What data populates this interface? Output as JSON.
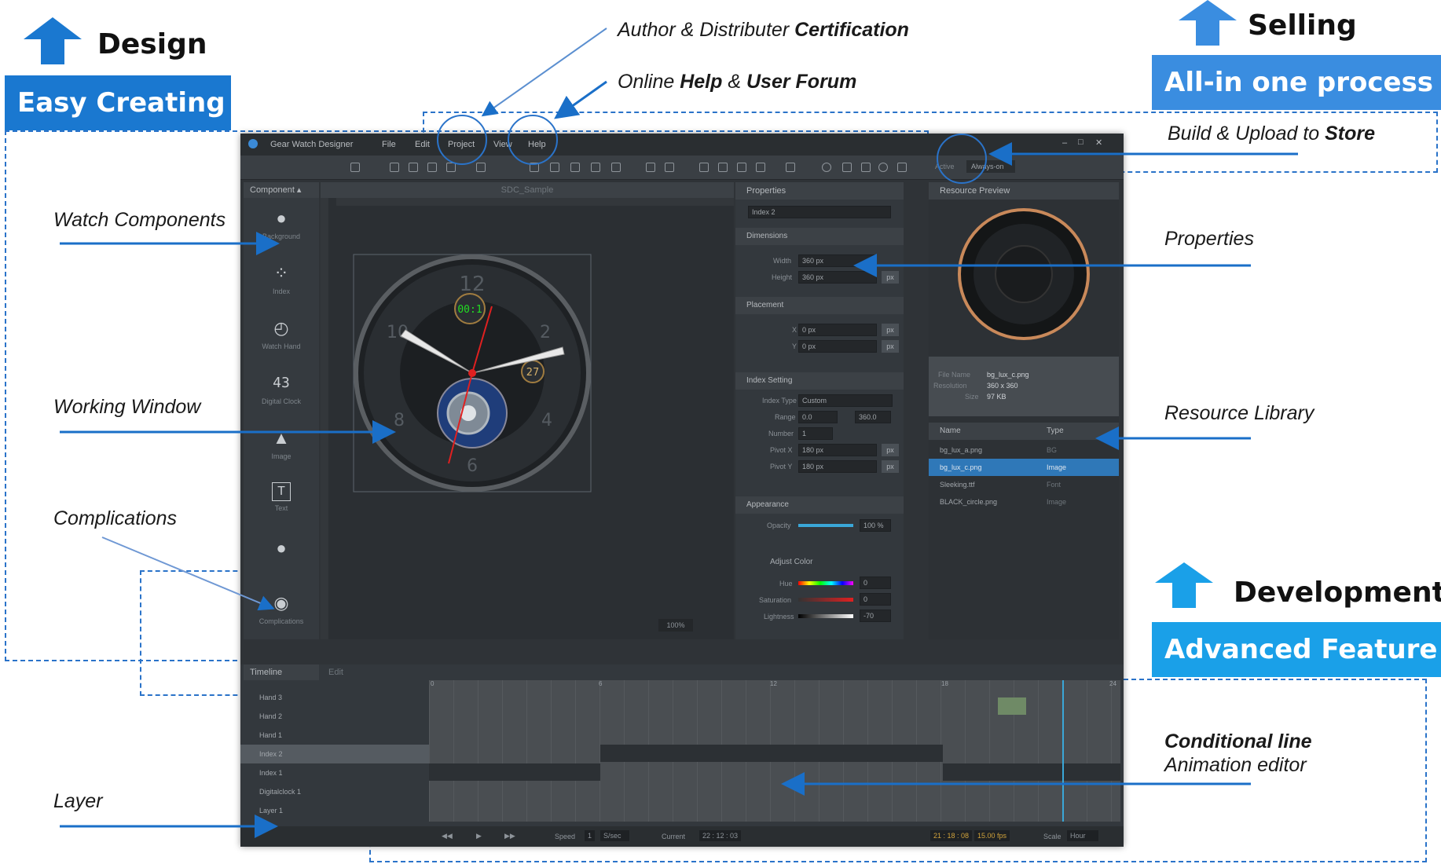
{
  "sections": {
    "design": {
      "title": "Design",
      "banner": "Easy Creating"
    },
    "selling": {
      "title": "Selling",
      "banner": "All-in one process"
    },
    "development": {
      "title": "Development",
      "banner": "Advanced Feature"
    }
  },
  "callouts": {
    "author_prefix": "Author & Distributer ",
    "author_bold": "Certification",
    "online_prefix": "Online ",
    "online_bold1": "Help",
    "online_mid": " & ",
    "online_bold2": "User Forum",
    "build": "Build & Upload to ",
    "build_bold": "Store",
    "watch_components": "Watch Components",
    "working_window": "Working Window",
    "complications": "Complications",
    "layer": "Layer",
    "properties": "Properties",
    "resource_library": "Resource Library",
    "conditional_line": "Conditional line",
    "animation_editor": "Animation editor"
  },
  "app": {
    "title": "Gear Watch Designer",
    "menu": [
      "File",
      "Edit",
      "Project",
      "View",
      "Help"
    ],
    "toolbar_active_label": "Active",
    "toolbar_mode": "Always-on",
    "component_tab": "Component",
    "canvas_tab": "SDC_Sample",
    "components": [
      {
        "label": "Background",
        "icon": "clock-icon"
      },
      {
        "label": "Index",
        "icon": "index-icon"
      },
      {
        "label": "Watch Hand",
        "icon": "watch-hand-icon"
      },
      {
        "label": "Digital Clock",
        "icon": "digital-clock-icon"
      },
      {
        "label": "Image",
        "icon": "image-icon"
      },
      {
        "label": "Text",
        "icon": "text-icon"
      },
      {
        "label": "",
        "icon": "effect-icon"
      },
      {
        "label": "Complications",
        "icon": "complications-icon"
      }
    ],
    "zoom": "100%",
    "watch": {
      "digital": "00:1",
      "numbers": [
        "12",
        "2",
        "4",
        "6",
        "8",
        "10"
      ],
      "date": "27"
    },
    "properties": {
      "title": "Properties",
      "selected": "Index 2",
      "dimensions": {
        "title": "Dimensions",
        "width_label": "Width",
        "width": "360 px",
        "height_label": "Height",
        "height": "360 px",
        "unit": "px"
      },
      "placement": {
        "title": "Placement",
        "x_label": "X",
        "x": "0 px",
        "y_label": "Y",
        "y": "0 px",
        "unit": "px"
      },
      "index_setting": {
        "title": "Index Setting",
        "type_label": "Index Type",
        "type": "Custom",
        "range_label": "Range",
        "range_from": "0.0",
        "range_to": "360.0",
        "number_label": "Number",
        "number": "1",
        "pivotx_label": "Pivot X",
        "pivotx": "180 px",
        "pivoty_label": "Pivot Y",
        "pivoty": "180 px",
        "unit": "px"
      },
      "appearance": {
        "title": "Appearance",
        "opacity_label": "Opacity",
        "opacity": "100 %",
        "opacity_level": 1.0,
        "adjust_color": "Adjust Color",
        "hue_label": "Hue",
        "hue": "0",
        "saturation_label": "Saturation",
        "saturation": "0",
        "lightness_label": "Lightness",
        "lightness": "-70"
      }
    },
    "resource": {
      "title": "Resource Preview",
      "file_name_label": "File Name",
      "file_name": "bg_lux_c.png",
      "resolution_label": "Resolution",
      "resolution": "360 x 360",
      "size_label": "Size",
      "size": "97 KB",
      "col_name": "Name",
      "col_type": "Type",
      "files": [
        {
          "name": "bg_lux_a.png",
          "type": "BG"
        },
        {
          "name": "bg_lux_c.png",
          "type": "Image"
        },
        {
          "name": "Sleeking.ttf",
          "type": "Font"
        },
        {
          "name": "BLACK_circle.png",
          "type": "Image"
        }
      ]
    },
    "timeline": {
      "tab1": "Timeline",
      "tab2": "Edit",
      "layers": [
        "Hand 3",
        "Hand 2",
        "Hand 1",
        "Index 2",
        "Index 1",
        "Digitalclock 1",
        "Layer 1"
      ],
      "ruler": [
        "0",
        "6",
        "12",
        "18",
        "24"
      ],
      "speed_label": "Speed",
      "speed": "1",
      "speed_unit": "S/sec",
      "current_label": "Current",
      "current": "22 : 12 : 03",
      "time": "21 : 18 : 08",
      "fps": "15.00 fps",
      "scale_label": "Scale",
      "scale": "Hour"
    }
  }
}
